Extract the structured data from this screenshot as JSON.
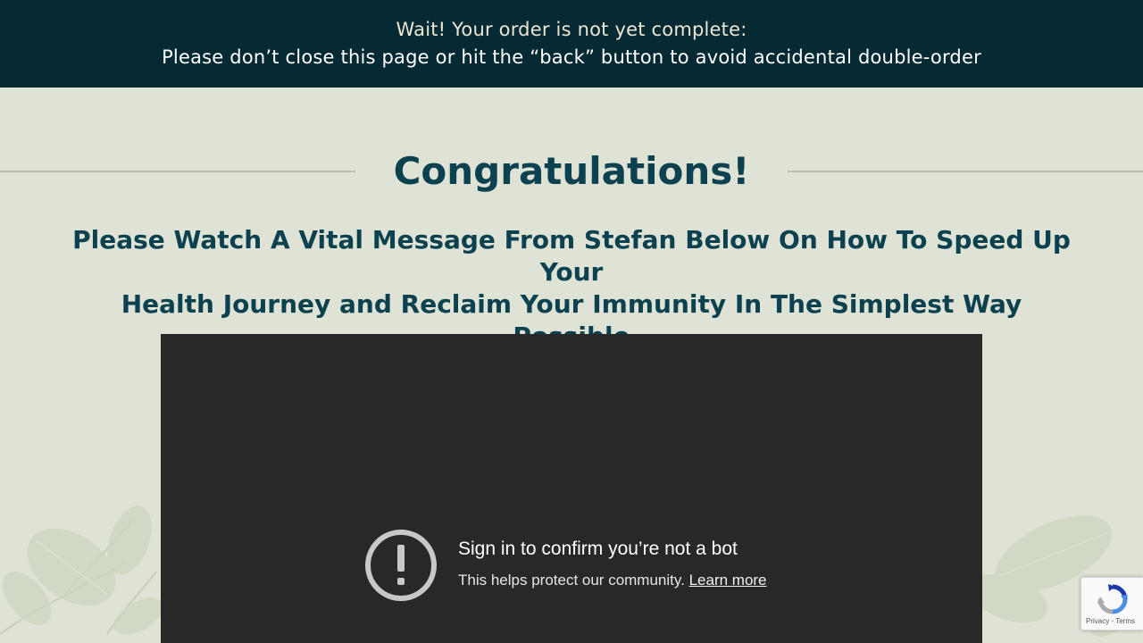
{
  "banner": {
    "line1": "Wait! Your order is not yet complete:",
    "line2": "Please don’t close this page or hit the “back” button to avoid accidental double-order"
  },
  "heading": {
    "title": "Congratulations!",
    "subtitle_line1": "Please Watch A Vital Message From Stefan Below On How To Speed Up Your",
    "subtitle_line2": "Health Journey and Reclaim Your Immunity In The Simplest Way Possible"
  },
  "video": {
    "icon": "warning-circle-icon",
    "heading": "Sign in to confirm you’re not a bot",
    "body": "This helps protect our community.",
    "learn_more": "Learn more"
  },
  "recaptcha": {
    "icon": "recaptcha-logo-icon",
    "privacy": "Privacy",
    "separator": " - ",
    "terms": "Terms"
  },
  "colors": {
    "banner_bg": "#062a34",
    "page_bg": "#dfe3d6",
    "heading_text": "#0c4150",
    "video_bg": "#282828"
  }
}
